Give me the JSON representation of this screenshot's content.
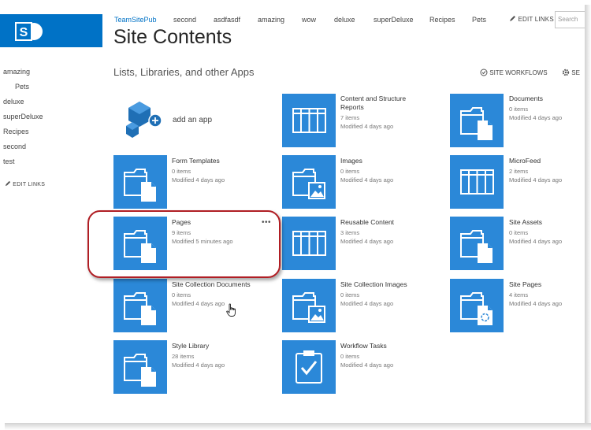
{
  "top_nav": {
    "links": [
      {
        "label": "TeamSitePub"
      },
      {
        "label": "second"
      },
      {
        "label": "asdfasdf"
      },
      {
        "label": "amazing"
      },
      {
        "label": "wow"
      },
      {
        "label": "deluxe"
      },
      {
        "label": "superDeluxe"
      },
      {
        "label": "Recipes"
      },
      {
        "label": "Pets"
      }
    ],
    "edit_links": "EDIT LINKS",
    "search_placeholder": "Search"
  },
  "page": {
    "title": "Site Contents",
    "section_title": "Lists, Libraries, and other Apps",
    "site_workflows": "SITE WORKFLOWS",
    "settings": "SE"
  },
  "left_nav": {
    "items": [
      {
        "label": "amazing"
      },
      {
        "label": "Pets"
      },
      {
        "label": "deluxe"
      },
      {
        "label": "superDeluxe"
      },
      {
        "label": "Recipes"
      },
      {
        "label": "second"
      },
      {
        "label": "test"
      }
    ],
    "edit_links": "EDIT LINKS"
  },
  "apps": {
    "add_app": "add an app",
    "tiles": [
      {
        "name": "Content and Structure Reports",
        "count": "7 items",
        "modified": "Modified 4 days ago",
        "icon": "list-icon"
      },
      {
        "name": "Documents",
        "count": "0 items",
        "modified": "Modified 4 days ago",
        "icon": "folder-doc-icon"
      },
      {
        "name": "Form Templates",
        "count": "0 items",
        "modified": "Modified 4 days ago",
        "icon": "folder-doc-icon"
      },
      {
        "name": "Images",
        "count": "0 items",
        "modified": "Modified 4 days ago",
        "icon": "folder-image-icon"
      },
      {
        "name": "MicroFeed",
        "count": "2 items",
        "modified": "Modified 4 days ago",
        "icon": "list-icon"
      },
      {
        "name": "Pages",
        "count": "9 items",
        "modified": "Modified 5 minutes ago",
        "icon": "folder-doc-icon"
      },
      {
        "name": "Reusable Content",
        "count": "3 items",
        "modified": "Modified 4 days ago",
        "icon": "list-icon"
      },
      {
        "name": "Site Assets",
        "count": "0 items",
        "modified": "Modified 4 days ago",
        "icon": "folder-doc-icon"
      },
      {
        "name": "Site Collection Documents",
        "count": "0 items",
        "modified": "Modified 4 days ago",
        "icon": "folder-doc-icon"
      },
      {
        "name": "Site Collection Images",
        "count": "0 items",
        "modified": "Modified 4 days ago",
        "icon": "folder-image-icon"
      },
      {
        "name": "Site Pages",
        "count": "4 items",
        "modified": "Modified 4 days ago",
        "icon": "folder-pages-icon"
      },
      {
        "name": "Style Library",
        "count": "28 items",
        "modified": "Modified 4 days ago",
        "icon": "folder-doc-icon"
      },
      {
        "name": "Workflow Tasks",
        "count": "0 items",
        "modified": "Modified 4 days ago",
        "icon": "tasks-icon"
      }
    ]
  },
  "colors": {
    "tile_blue": "#2b88d8",
    "brand_blue": "#0072c6",
    "highlight_red": "#b01e24"
  }
}
